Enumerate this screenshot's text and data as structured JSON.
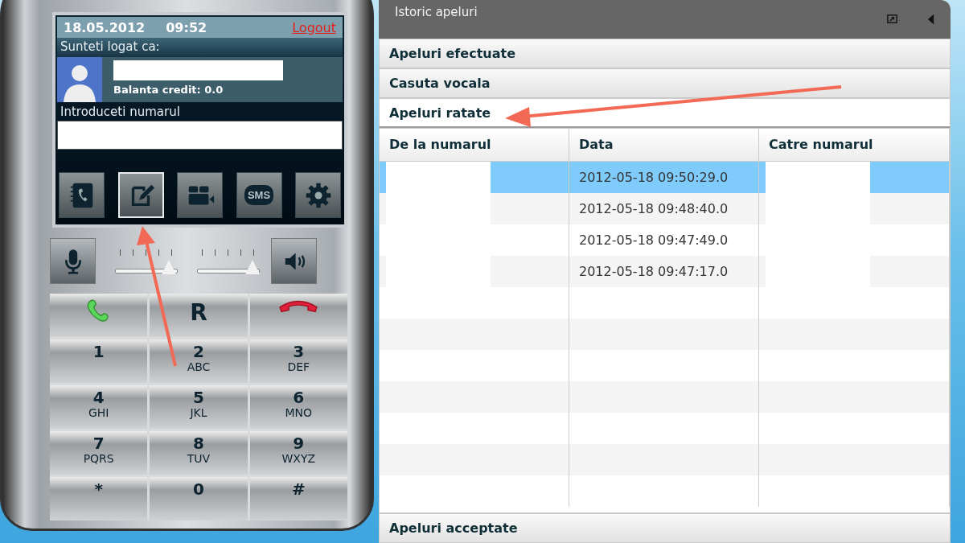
{
  "phone": {
    "date": "18.05.2012",
    "time": "09:52",
    "logout": "Logout",
    "logged_as": "Sunteti logat ca:",
    "balance": "Balanta credit: 0.0",
    "number_label": "Introduceti numarul",
    "toolbar": [
      {
        "kind": "contacts",
        "selected": false
      },
      {
        "kind": "notes",
        "selected": true
      },
      {
        "kind": "video",
        "selected": false
      },
      {
        "kind": "sms",
        "label": "SMS",
        "selected": false
      },
      {
        "kind": "settings",
        "selected": false
      }
    ],
    "mic_volume": {
      "level": 0.87
    },
    "speaker_volume": {
      "level": 0.9
    },
    "keys": [
      {
        "kind": "call"
      },
      {
        "kind": "text",
        "digit": "R"
      },
      {
        "kind": "hangup"
      },
      {
        "kind": "text",
        "digit": "1"
      },
      {
        "kind": "text",
        "digit": "2",
        "letters": "ABC"
      },
      {
        "kind": "text",
        "digit": "3",
        "letters": "DEF"
      },
      {
        "kind": "text",
        "digit": "4",
        "letters": "GHI"
      },
      {
        "kind": "text",
        "digit": "5",
        "letters": "JKL"
      },
      {
        "kind": "text",
        "digit": "6",
        "letters": "MNO"
      },
      {
        "kind": "text",
        "digit": "7",
        "letters": "PQRS"
      },
      {
        "kind": "text",
        "digit": "8",
        "letters": "TUV"
      },
      {
        "kind": "text",
        "digit": "9",
        "letters": "WXYZ"
      },
      {
        "kind": "text",
        "digit": "*"
      },
      {
        "kind": "text",
        "digit": "0"
      },
      {
        "kind": "text",
        "digit": "#"
      }
    ]
  },
  "panel": {
    "title": "Istoric apeluri",
    "sections": [
      {
        "label": "Apeluri efectuate",
        "expanded": false
      },
      {
        "label": "Casuta vocala",
        "expanded": false
      },
      {
        "label": "Apeluri ratate",
        "expanded": true
      },
      {
        "label": "Apeluri acceptate",
        "expanded": false
      }
    ],
    "table": {
      "columns": [
        "De la numarul",
        "Data",
        "Catre numarul"
      ],
      "rows": [
        {
          "date": "2012-05-18 09:50:29.0",
          "selected": true
        },
        {
          "date": "2012-05-18 09:48:40.0",
          "selected": false
        },
        {
          "date": "2012-05-18 09:47:49.0",
          "selected": false
        },
        {
          "date": "2012-05-18 09:47:17.0",
          "selected": false
        }
      ]
    }
  }
}
